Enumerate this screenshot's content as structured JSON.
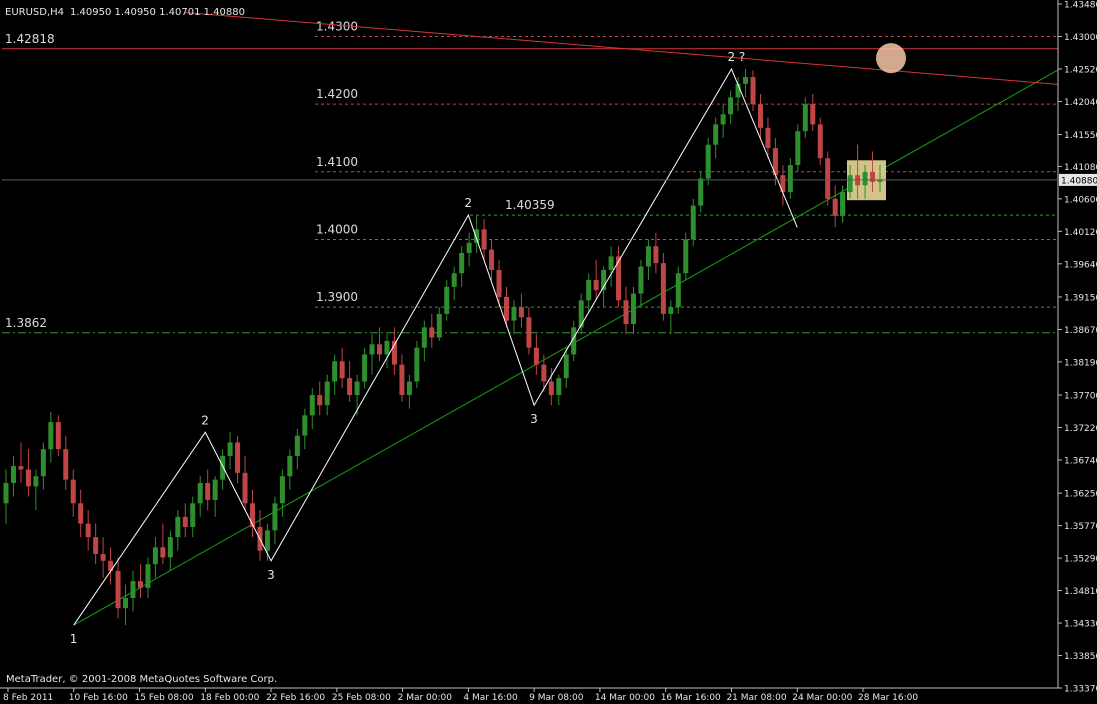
{
  "header": {
    "symbol": "EURUSD,H4",
    "quote": "1.40950 1.40950 1.40701 1.40880"
  },
  "footer": {
    "copyright": "MetaTrader, © 2001-2008 MetaQuotes Software Corp."
  },
  "colors": {
    "background": "#000000",
    "candle_up": "#2f8f2f",
    "candle_down": "#c04545",
    "wave_line": "#ffffff",
    "trend_line": "#13a013",
    "resistance_line": "#d23737",
    "level_red": "#c44444",
    "level_green": "#2aa02a",
    "highlight_box": "#f5e6a0",
    "circle_marker": "#f7c6a8"
  },
  "chart_data": {
    "type": "candlestick",
    "symbol": "EURUSD",
    "timeframe": "H4",
    "ylim": [
      1.3337,
      1.4348
    ],
    "price_axis_ticks": [
      "1.43480",
      "1.43000",
      "1.42520",
      "1.42040",
      "1.41550",
      "1.41080",
      "1.40600",
      "1.40120",
      "1.39640",
      "1.39150",
      "1.38670",
      "1.38190",
      "1.37700",
      "1.37220",
      "1.36740",
      "1.36250",
      "1.35770",
      "1.35290",
      "1.34810",
      "1.34330",
      "1.33850",
      "1.33370"
    ],
    "current_price": {
      "value": 1.4088,
      "label": "1.40880"
    },
    "time_axis_labels": [
      "8 Feb 2011",
      "10 Feb 16:00",
      "15 Feb 08:00",
      "18 Feb 00:00",
      "22 Feb 16:00",
      "25 Feb 08:00",
      "2 Mar 00:00",
      "4 Mar 16:00",
      "9 Mar 08:00",
      "14 Mar 00:00",
      "16 Mar 16:00",
      "21 Mar 08:00",
      "24 Mar 00:00",
      "28 Mar 16:00"
    ],
    "horizontal_levels": [
      {
        "label": "1.4300",
        "value": 1.43,
        "color": "red",
        "style": "dashed"
      },
      {
        "label": "1.4200",
        "value": 1.42,
        "color": "red",
        "style": "dashed"
      },
      {
        "label": "1.4100",
        "value": 1.41,
        "color": "red",
        "style": "dashed"
      },
      {
        "label": "1.40359",
        "value": 1.40359,
        "color": "green",
        "style": "dashed"
      },
      {
        "label": "1.4000",
        "value": 1.4,
        "color": "green",
        "style": "dashed"
      },
      {
        "label": "1.3900",
        "value": 1.39,
        "color": "green",
        "style": "dashed"
      },
      {
        "label": "1.3862",
        "value": 1.3862,
        "color": "green",
        "style": "dashdot"
      },
      {
        "label": "1.42818",
        "value": 1.42818,
        "color": "red",
        "style": "solid"
      }
    ],
    "wave_labels": [
      {
        "text": "1",
        "time": "10 Feb 16:00",
        "price": 1.343
      },
      {
        "text": "2",
        "time": "18 Feb 00:00",
        "price": 1.3715
      },
      {
        "text": "3",
        "time": "22 Feb 16:00",
        "price": 1.3525
      },
      {
        "text": "2",
        "time": "4 Mar 16:00",
        "price": 1.4036
      },
      {
        "text": "3",
        "time": "9 Mar 08:00",
        "price": 1.3755
      },
      {
        "text": "2 ?",
        "time": "21 Mar 08:00",
        "price": 1.4252
      }
    ],
    "wave_path": [
      {
        "time": "10 Feb 16:00",
        "price": 1.343
      },
      {
        "time": "18 Feb 00:00",
        "price": 1.3715
      },
      {
        "time": "22 Feb 16:00",
        "price": 1.3525
      },
      {
        "time": "4 Mar 16:00",
        "price": 1.4036
      },
      {
        "time": "9 Mar 08:00",
        "price": 1.3755
      },
      {
        "time": "21 Mar 08:00",
        "price": 1.4252
      },
      {
        "time": "24 Mar 00:00",
        "price": 1.4018
      }
    ],
    "trendlines": [
      {
        "name": "support",
        "color": "green",
        "from": {
          "time": "10 Feb 16:00",
          "price": 1.343
        },
        "to": {
          "time": "28 Mar 16:00",
          "price": 1.4088
        }
      },
      {
        "name": "resistance",
        "color": "red",
        "from": {
          "time": "15 Feb 08:00",
          "price": 1.4341
        },
        "to": {
          "time": "28 Mar 16:00",
          "price": 1.4253
        }
      }
    ],
    "candles_ohlc": [
      [
        1.361,
        1.366,
        1.358,
        1.364
      ],
      [
        1.364,
        1.368,
        1.362,
        1.3665
      ],
      [
        1.3665,
        1.37,
        1.364,
        1.366
      ],
      [
        1.366,
        1.369,
        1.362,
        1.3635
      ],
      [
        1.3635,
        1.366,
        1.36,
        1.365
      ],
      [
        1.365,
        1.37,
        1.363,
        1.369
      ],
      [
        1.369,
        1.3745,
        1.367,
        1.373
      ],
      [
        1.373,
        1.374,
        1.368,
        1.369
      ],
      [
        1.369,
        1.371,
        1.363,
        1.3645
      ],
      [
        1.3645,
        1.366,
        1.359,
        1.361
      ],
      [
        1.361,
        1.363,
        1.356,
        1.358
      ],
      [
        1.358,
        1.36,
        1.354,
        1.356
      ],
      [
        1.356,
        1.358,
        1.352,
        1.3535
      ],
      [
        1.3535,
        1.356,
        1.35,
        1.3525
      ],
      [
        1.3525,
        1.3545,
        1.349,
        1.351
      ],
      [
        1.351,
        1.353,
        1.344,
        1.3455
      ],
      [
        1.3455,
        1.349,
        1.343,
        1.347
      ],
      [
        1.347,
        1.351,
        1.345,
        1.3495
      ],
      [
        1.3495,
        1.352,
        1.347,
        1.3485
      ],
      [
        1.3485,
        1.353,
        1.347,
        1.352
      ],
      [
        1.352,
        1.356,
        1.35,
        1.3545
      ],
      [
        1.3545,
        1.358,
        1.352,
        1.353
      ],
      [
        1.353,
        1.357,
        1.351,
        1.356
      ],
      [
        1.356,
        1.36,
        1.354,
        1.359
      ],
      [
        1.359,
        1.361,
        1.356,
        1.3575
      ],
      [
        1.3575,
        1.362,
        1.356,
        1.361
      ],
      [
        1.361,
        1.365,
        1.359,
        1.364
      ],
      [
        1.364,
        1.366,
        1.36,
        1.3615
      ],
      [
        1.3615,
        1.365,
        1.359,
        1.3645
      ],
      [
        1.3645,
        1.369,
        1.363,
        1.368
      ],
      [
        1.368,
        1.3715,
        1.366,
        1.37
      ],
      [
        1.37,
        1.371,
        1.364,
        1.3655
      ],
      [
        1.3655,
        1.368,
        1.36,
        1.361
      ],
      [
        1.361,
        1.363,
        1.356,
        1.3575
      ],
      [
        1.3575,
        1.36,
        1.3525,
        1.354
      ],
      [
        1.354,
        1.358,
        1.3525,
        1.357
      ],
      [
        1.357,
        1.362,
        1.355,
        1.361
      ],
      [
        1.361,
        1.366,
        1.359,
        1.365
      ],
      [
        1.365,
        1.369,
        1.363,
        1.368
      ],
      [
        1.368,
        1.372,
        1.366,
        1.371
      ],
      [
        1.371,
        1.375,
        1.369,
        1.374
      ],
      [
        1.374,
        1.378,
        1.372,
        1.377
      ],
      [
        1.377,
        1.379,
        1.374,
        1.3755
      ],
      [
        1.3755,
        1.38,
        1.374,
        1.379
      ],
      [
        1.379,
        1.383,
        1.377,
        1.382
      ],
      [
        1.382,
        1.384,
        1.378,
        1.3795
      ],
      [
        1.3795,
        1.382,
        1.376,
        1.377
      ],
      [
        1.377,
        1.38,
        1.374,
        1.379
      ],
      [
        1.379,
        1.384,
        1.378,
        1.383
      ],
      [
        1.383,
        1.386,
        1.38,
        1.3845
      ],
      [
        1.3845,
        1.387,
        1.382,
        1.383
      ],
      [
        1.383,
        1.386,
        1.381,
        1.385
      ],
      [
        1.385,
        1.387,
        1.38,
        1.3815
      ],
      [
        1.3815,
        1.383,
        1.376,
        1.377
      ],
      [
        1.377,
        1.38,
        1.375,
        1.379
      ],
      [
        1.379,
        1.385,
        1.378,
        1.384
      ],
      [
        1.384,
        1.388,
        1.382,
        1.387
      ],
      [
        1.387,
        1.389,
        1.384,
        1.3855
      ],
      [
        1.3855,
        1.39,
        1.385,
        1.389
      ],
      [
        1.389,
        1.394,
        1.388,
        1.393
      ],
      [
        1.393,
        1.396,
        1.391,
        1.395
      ],
      [
        1.395,
        1.399,
        1.393,
        1.398
      ],
      [
        1.398,
        1.401,
        1.396,
        1.3995
      ],
      [
        1.3995,
        1.4036,
        1.398,
        1.4015
      ],
      [
        1.4015,
        1.403,
        1.397,
        1.3985
      ],
      [
        1.3985,
        1.4,
        1.394,
        1.3955
      ],
      [
        1.3955,
        1.397,
        1.39,
        1.3915
      ],
      [
        1.3915,
        1.393,
        1.387,
        1.388
      ],
      [
        1.388,
        1.391,
        1.386,
        1.39
      ],
      [
        1.39,
        1.392,
        1.387,
        1.3885
      ],
      [
        1.3885,
        1.39,
        1.383,
        1.384
      ],
      [
        1.384,
        1.386,
        1.38,
        1.3815
      ],
      [
        1.3815,
        1.383,
        1.3775,
        1.379
      ],
      [
        1.379,
        1.381,
        1.3755,
        1.377
      ],
      [
        1.377,
        1.38,
        1.3755,
        1.3795
      ],
      [
        1.3795,
        1.384,
        1.378,
        1.383
      ],
      [
        1.383,
        1.388,
        1.382,
        1.387
      ],
      [
        1.387,
        1.392,
        1.386,
        1.391
      ],
      [
        1.391,
        1.395,
        1.389,
        1.394
      ],
      [
        1.394,
        1.397,
        1.391,
        1.3925
      ],
      [
        1.3925,
        1.396,
        1.39,
        1.3955
      ],
      [
        1.3955,
        1.399,
        1.393,
        1.3975
      ],
      [
        1.3975,
        1.399,
        1.39,
        1.391
      ],
      [
        1.391,
        1.393,
        1.386,
        1.3875
      ],
      [
        1.3875,
        1.393,
        1.386,
        1.392
      ],
      [
        1.392,
        1.397,
        1.39,
        1.396
      ],
      [
        1.396,
        1.4,
        1.394,
        1.399
      ],
      [
        1.399,
        1.401,
        1.395,
        1.3965
      ],
      [
        1.3965,
        1.398,
        1.388,
        1.389
      ],
      [
        1.389,
        1.391,
        1.386,
        1.39
      ],
      [
        1.39,
        1.396,
        1.389,
        1.395
      ],
      [
        1.395,
        1.401,
        1.394,
        1.4
      ],
      [
        1.4,
        1.406,
        1.399,
        1.405
      ],
      [
        1.405,
        1.41,
        1.404,
        1.409
      ],
      [
        1.409,
        1.415,
        1.408,
        1.414
      ],
      [
        1.414,
        1.418,
        1.412,
        1.417
      ],
      [
        1.417,
        1.42,
        1.415,
        1.4185
      ],
      [
        1.4185,
        1.422,
        1.417,
        1.421
      ],
      [
        1.421,
        1.424,
        1.419,
        1.423
      ],
      [
        1.423,
        1.4252,
        1.421,
        1.424
      ],
      [
        1.424,
        1.425,
        1.419,
        1.42
      ],
      [
        1.42,
        1.4215,
        1.415,
        1.4165
      ],
      [
        1.4165,
        1.418,
        1.412,
        1.4135
      ],
      [
        1.4135,
        1.415,
        1.408,
        1.4095
      ],
      [
        1.4095,
        1.411,
        1.405,
        1.407
      ],
      [
        1.407,
        1.412,
        1.406,
        1.411
      ],
      [
        1.411,
        1.417,
        1.41,
        1.416
      ],
      [
        1.416,
        1.421,
        1.415,
        1.42
      ],
      [
        1.42,
        1.4215,
        1.416,
        1.417
      ],
      [
        1.417,
        1.418,
        1.411,
        1.412
      ],
      [
        1.412,
        1.413,
        1.405,
        1.406
      ],
      [
        1.406,
        1.408,
        1.4018,
        1.4035
      ],
      [
        1.4035,
        1.408,
        1.4025,
        1.407
      ],
      [
        1.407,
        1.411,
        1.406,
        1.4095
      ],
      [
        1.4095,
        1.414,
        1.406,
        1.408
      ],
      [
        1.408,
        1.411,
        1.406,
        1.41
      ],
      [
        1.41,
        1.413,
        1.407,
        1.4085
      ],
      [
        1.4085,
        1.411,
        1.407,
        1.4088
      ]
    ]
  }
}
